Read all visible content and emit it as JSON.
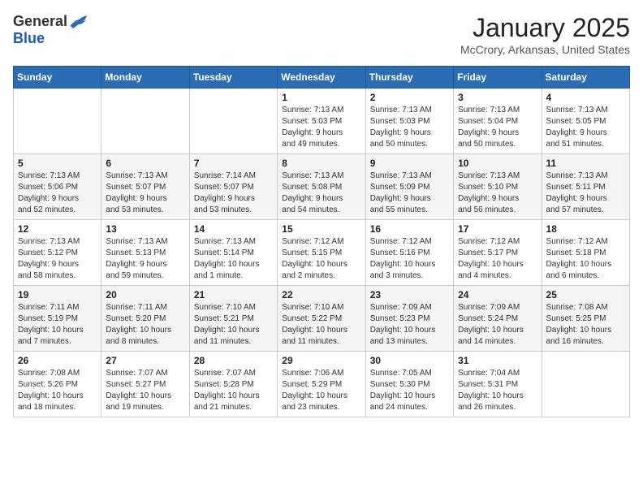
{
  "logo": {
    "general": "General",
    "blue": "Blue"
  },
  "title": "January 2025",
  "subtitle": "McCrory, Arkansas, United States",
  "weekdays": [
    "Sunday",
    "Monday",
    "Tuesday",
    "Wednesday",
    "Thursday",
    "Friday",
    "Saturday"
  ],
  "weeks": [
    [
      {
        "day": "",
        "info": ""
      },
      {
        "day": "",
        "info": ""
      },
      {
        "day": "",
        "info": ""
      },
      {
        "day": "1",
        "info": "Sunrise: 7:13 AM\nSunset: 5:03 PM\nDaylight: 9 hours\nand 49 minutes."
      },
      {
        "day": "2",
        "info": "Sunrise: 7:13 AM\nSunset: 5:03 PM\nDaylight: 9 hours\nand 50 minutes."
      },
      {
        "day": "3",
        "info": "Sunrise: 7:13 AM\nSunset: 5:04 PM\nDaylight: 9 hours\nand 50 minutes."
      },
      {
        "day": "4",
        "info": "Sunrise: 7:13 AM\nSunset: 5:05 PM\nDaylight: 9 hours\nand 51 minutes."
      }
    ],
    [
      {
        "day": "5",
        "info": "Sunrise: 7:13 AM\nSunset: 5:06 PM\nDaylight: 9 hours\nand 52 minutes."
      },
      {
        "day": "6",
        "info": "Sunrise: 7:13 AM\nSunset: 5:07 PM\nDaylight: 9 hours\nand 53 minutes."
      },
      {
        "day": "7",
        "info": "Sunrise: 7:14 AM\nSunset: 5:07 PM\nDaylight: 9 hours\nand 53 minutes."
      },
      {
        "day": "8",
        "info": "Sunrise: 7:13 AM\nSunset: 5:08 PM\nDaylight: 9 hours\nand 54 minutes."
      },
      {
        "day": "9",
        "info": "Sunrise: 7:13 AM\nSunset: 5:09 PM\nDaylight: 9 hours\nand 55 minutes."
      },
      {
        "day": "10",
        "info": "Sunrise: 7:13 AM\nSunset: 5:10 PM\nDaylight: 9 hours\nand 56 minutes."
      },
      {
        "day": "11",
        "info": "Sunrise: 7:13 AM\nSunset: 5:11 PM\nDaylight: 9 hours\nand 57 minutes."
      }
    ],
    [
      {
        "day": "12",
        "info": "Sunrise: 7:13 AM\nSunset: 5:12 PM\nDaylight: 9 hours\nand 58 minutes."
      },
      {
        "day": "13",
        "info": "Sunrise: 7:13 AM\nSunset: 5:13 PM\nDaylight: 9 hours\nand 59 minutes."
      },
      {
        "day": "14",
        "info": "Sunrise: 7:13 AM\nSunset: 5:14 PM\nDaylight: 10 hours\nand 1 minute."
      },
      {
        "day": "15",
        "info": "Sunrise: 7:12 AM\nSunset: 5:15 PM\nDaylight: 10 hours\nand 2 minutes."
      },
      {
        "day": "16",
        "info": "Sunrise: 7:12 AM\nSunset: 5:16 PM\nDaylight: 10 hours\nand 3 minutes."
      },
      {
        "day": "17",
        "info": "Sunrise: 7:12 AM\nSunset: 5:17 PM\nDaylight: 10 hours\nand 4 minutes."
      },
      {
        "day": "18",
        "info": "Sunrise: 7:12 AM\nSunset: 5:18 PM\nDaylight: 10 hours\nand 6 minutes."
      }
    ],
    [
      {
        "day": "19",
        "info": "Sunrise: 7:11 AM\nSunset: 5:19 PM\nDaylight: 10 hours\nand 7 minutes."
      },
      {
        "day": "20",
        "info": "Sunrise: 7:11 AM\nSunset: 5:20 PM\nDaylight: 10 hours\nand 8 minutes."
      },
      {
        "day": "21",
        "info": "Sunrise: 7:10 AM\nSunset: 5:21 PM\nDaylight: 10 hours\nand 11 minutes."
      },
      {
        "day": "22",
        "info": "Sunrise: 7:10 AM\nSunset: 5:22 PM\nDaylight: 10 hours\nand 11 minutes."
      },
      {
        "day": "23",
        "info": "Sunrise: 7:09 AM\nSunset: 5:23 PM\nDaylight: 10 hours\nand 13 minutes."
      },
      {
        "day": "24",
        "info": "Sunrise: 7:09 AM\nSunset: 5:24 PM\nDaylight: 10 hours\nand 14 minutes."
      },
      {
        "day": "25",
        "info": "Sunrise: 7:08 AM\nSunset: 5:25 PM\nDaylight: 10 hours\nand 16 minutes."
      }
    ],
    [
      {
        "day": "26",
        "info": "Sunrise: 7:08 AM\nSunset: 5:26 PM\nDaylight: 10 hours\nand 18 minutes."
      },
      {
        "day": "27",
        "info": "Sunrise: 7:07 AM\nSunset: 5:27 PM\nDaylight: 10 hours\nand 19 minutes."
      },
      {
        "day": "28",
        "info": "Sunrise: 7:07 AM\nSunset: 5:28 PM\nDaylight: 10 hours\nand 21 minutes."
      },
      {
        "day": "29",
        "info": "Sunrise: 7:06 AM\nSunset: 5:29 PM\nDaylight: 10 hours\nand 23 minutes."
      },
      {
        "day": "30",
        "info": "Sunrise: 7:05 AM\nSunset: 5:30 PM\nDaylight: 10 hours\nand 24 minutes."
      },
      {
        "day": "31",
        "info": "Sunrise: 7:04 AM\nSunset: 5:31 PM\nDaylight: 10 hours\nand 26 minutes."
      },
      {
        "day": "",
        "info": ""
      }
    ]
  ]
}
